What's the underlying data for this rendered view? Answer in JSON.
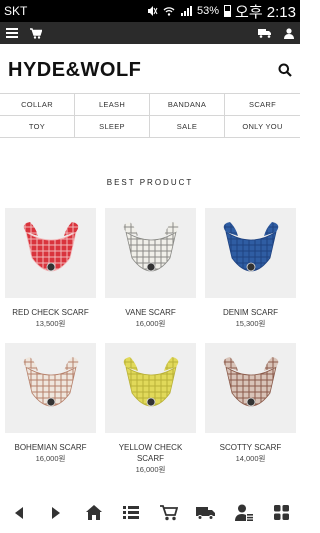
{
  "status_bar": {
    "carrier": "SKT",
    "battery_percent": "53%",
    "battery_level": 0.53,
    "time": "오후 2:13"
  },
  "app_bar": {
    "left_icons": [
      "menu-icon",
      "cart-icon"
    ],
    "right_icons": [
      "delivery-truck-icon",
      "user-icon"
    ]
  },
  "header": {
    "logo": "HYDE&WOLF",
    "search_icon": "search-icon"
  },
  "categories": [
    "COLLAR",
    "LEASH",
    "BANDANA",
    "SCARF",
    "TOY",
    "SLEEP",
    "SALE",
    "ONLY YOU"
  ],
  "section_title": "BEST PRODUCT",
  "products": [
    {
      "name": "RED CHECK SCARF",
      "price": "13,500원",
      "color": "#d9343d",
      "pattern": "#f3b6b8"
    },
    {
      "name": "VANE SCARF",
      "price": "16,000원",
      "color": "#f0efe9",
      "pattern": "#8a8a86"
    },
    {
      "name": "DENIM SCARF",
      "price": "15,300원",
      "color": "#2f5da3",
      "pattern": "#1f4280"
    },
    {
      "name": "BOHEMIAN SCARF",
      "price": "16,000원",
      "color": "#efe6dd",
      "pattern": "#b6806a"
    },
    {
      "name": "YELLOW CHECK SCARF",
      "price": "16,000원",
      "color": "#e1d95a",
      "pattern": "#b9b138"
    },
    {
      "name": "SCOTTY SCARF",
      "price": "14,000원",
      "color": "#d8c3b8",
      "pattern": "#8a5a4a"
    }
  ],
  "bottom_nav": [
    "back-icon",
    "forward-icon",
    "home-icon",
    "list-icon",
    "cart-icon",
    "delivery-truck-icon",
    "my-page-icon",
    "grid-icon"
  ]
}
